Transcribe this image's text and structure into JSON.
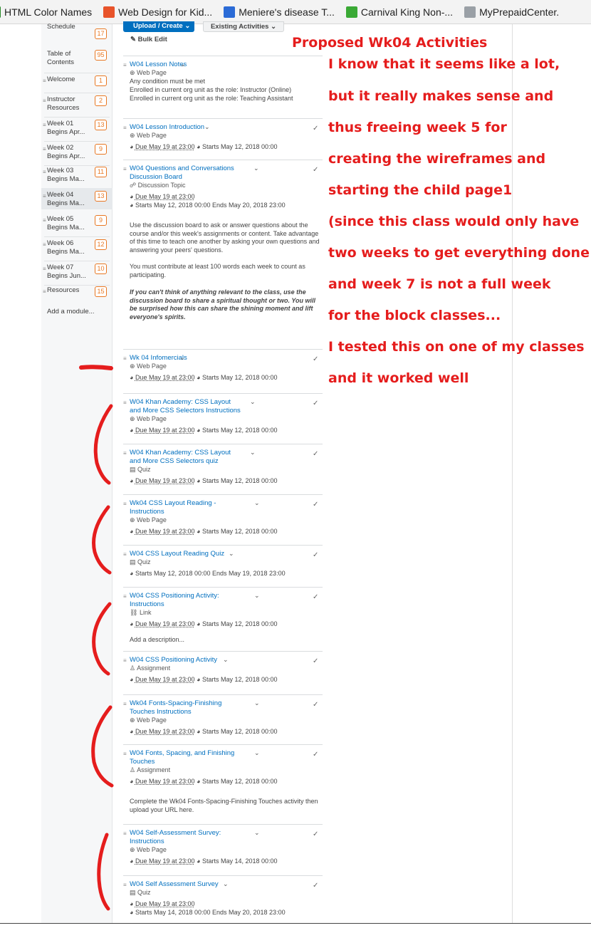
{
  "bookmarks": [
    {
      "label": "HTML Color Names",
      "icon": "html-bookmark-icon",
      "color": "#2a8a2a"
    },
    {
      "label": "Web Design for Kid...",
      "icon": "plus-bookmark-icon",
      "color": "#e8532a"
    },
    {
      "label": "Meniere's disease T...",
      "icon": "stethoscope-bookmark-icon",
      "color": "#2b6bd6"
    },
    {
      "label": "Carnival King Non-...",
      "icon": "carnival-bookmark-icon",
      "color": "#3aa935"
    },
    {
      "label": "MyPrepaidCenter.",
      "icon": "page-bookmark-icon",
      "color": "#9aa0a6"
    }
  ],
  "sidebar": {
    "items": [
      {
        "label": "Schedule",
        "count": "17"
      },
      {
        "label": "Table of Contents",
        "count": "95"
      },
      {
        "label": "Welcome",
        "count": "1"
      },
      {
        "label": "Instructor Resources",
        "count": "2"
      },
      {
        "label": "Week 01 Begins Apr...",
        "count": "13"
      },
      {
        "label": "Week 02 Begins Apr...",
        "count": "9"
      },
      {
        "label": "Week 03 Begins Ma...",
        "count": "11"
      },
      {
        "label": "Week 04 Begins Ma...",
        "count": "13"
      },
      {
        "label": "Week 05 Begins Ma...",
        "count": "9"
      },
      {
        "label": "Week 06 Begins Ma...",
        "count": "12"
      },
      {
        "label": "Week 07 Begins Jun...",
        "count": "10"
      },
      {
        "label": "Resources",
        "count": "15"
      }
    ],
    "add_module": "Add a module..."
  },
  "toolbar": {
    "upload_label": "Upload / Create",
    "existing_label": "Existing Activities",
    "bulk_label": "Bulk Edit"
  },
  "activities": [
    {
      "title": "W04 Lesson Notes",
      "type": "Web Page",
      "lines": [
        "Any condition must be met",
        "Enrolled in current org unit as the role: Instructor (Online)",
        "Enrolled in current org unit as the role: Teaching Assistant"
      ],
      "checked": false
    },
    {
      "title": "W04 Lesson Introduction",
      "type": "Web Page",
      "due": "Due May 19 at 23:00",
      "starts": "Starts May 12, 2018 00:00",
      "checked": true
    },
    {
      "title": "W04 Questions and Conversations Discussion Board",
      "type": "Discussion Topic",
      "due": "Due May 19 at 23:00",
      "starts": "Starts May 12, 2018 00:00 Ends May 20, 2018 23:00",
      "desc": [
        "Use the discussion board to ask or answer questions about the course and/or this week's assignments or content. Take advantage of this time to teach one another by asking your own questions and answering your peers' questions.",
        "You must contribute at least 100 words each week to count as participating.",
        "If you can't think of anything relevant to the class, use the discussion board to share a spiritual thought or two. You will be surprised how this can share the shining moment and lift everyone's spirits."
      ],
      "checked": true
    },
    {
      "title": "Wk 04 Infomercials",
      "type": "Web Page",
      "due": "Due May 19 at 23:00",
      "starts": "Starts May 12, 2018 00:00",
      "checked": true
    },
    {
      "title": "W04 Khan Academy: CSS Layout and More CSS Selectors Instructions",
      "type": "Web Page",
      "due": "Due May 19 at 23:00",
      "starts": "Starts May 12, 2018 00:00",
      "checked": true
    },
    {
      "title": "W04 Khan Academy: CSS Layout and More CSS Selectors quiz",
      "type": "Quiz",
      "due": "Due May 19 at 23:00",
      "starts": "Starts May 12, 2018 00:00",
      "checked": true
    },
    {
      "title": "Wk04 CSS Layout Reading - Instructions",
      "type": "Web Page",
      "due": "Due May 19 at 23:00",
      "starts": "Starts May 12, 2018 00:00",
      "checked": true
    },
    {
      "title": "W04 CSS Layout Reading Quiz",
      "type": "Quiz",
      "starts": "Starts May 12, 2018 00:00 Ends May 19, 2018 23:00",
      "checked": true
    },
    {
      "title": "W04 CSS Positioning Activity: Instructions",
      "type": "Link",
      "due": "Due May 19 at 23:00",
      "starts": "Starts May 12, 2018 00:00",
      "add_desc": "Add a description...",
      "checked": true
    },
    {
      "title": "W04 CSS Positioning Activity",
      "type": "Assignment",
      "due": "Due May 19 at 23:00",
      "starts": "Starts May 12, 2018 00:00",
      "checked": true
    },
    {
      "title": "Wk04 Fonts-Spacing-Finishing Touches Instructions",
      "type": "Web Page",
      "due": "Due May 19 at 23:00",
      "starts": "Starts May 12, 2018 00:00",
      "checked": true
    },
    {
      "title": "W04 Fonts, Spacing, and Finishing Touches",
      "type": "Assignment",
      "due": "Due May 19 at 23:00",
      "starts": "Starts May 12, 2018 00:00",
      "desc": [
        "Complete the Wk04 Fonts-Spacing-Finishing Touches activity then upload your URL here."
      ],
      "checked": true
    },
    {
      "title": "W04 Self-Assessment Survey: Instructions",
      "type": "Web Page",
      "due": "Due May 19 at 23:00",
      "starts": "Starts May 14, 2018 00:00",
      "checked": true
    },
    {
      "title": "W04 Self Assessment Survey",
      "type": "Quiz",
      "due": "Due May 19 at 23:00",
      "starts": "Starts May 14, 2018 00:00 Ends May 20, 2018 23:00",
      "checked": true
    }
  ],
  "annotation": {
    "title": "Proposed Wk04 Activities",
    "lines": [
      "I know that it seems like a lot,",
      "but it really makes sense and",
      "thus freeing week 5 for",
      "creating the wireframes and",
      "starting the child page1",
      "(since this class would only have",
      "two weeks to get everything done",
      "and week 7 is not a full week",
      "for the block classes...",
      "I tested this on one of my classes",
      "and it worked well"
    ],
    "color": "#e51d1d"
  },
  "colors": {
    "accent": "#006fbf",
    "badge": "#e87722"
  }
}
